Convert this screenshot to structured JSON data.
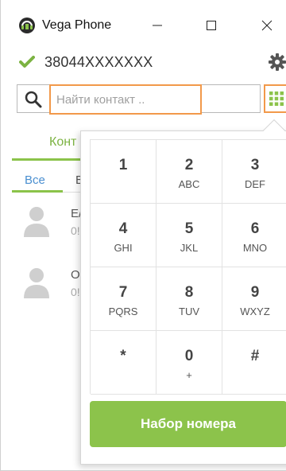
{
  "window": {
    "title": "Vega Phone"
  },
  "status": {
    "phone_number": "38044XXXXXXX",
    "online_color": "#7cb342"
  },
  "search": {
    "placeholder": "Найти контакт ..",
    "value": ""
  },
  "tabs": {
    "contacts_label": "Конт",
    "all_label": "Все",
    "second_label": "В"
  },
  "contacts": [
    {
      "name": "Е/",
      "sub": "0!"
    },
    {
      "name": "О",
      "sub": "0!"
    }
  ],
  "dialpad": {
    "keys": [
      {
        "digit": "1",
        "letters": ""
      },
      {
        "digit": "2",
        "letters": "ABC"
      },
      {
        "digit": "3",
        "letters": "DEF"
      },
      {
        "digit": "4",
        "letters": "GHI"
      },
      {
        "digit": "5",
        "letters": "JKL"
      },
      {
        "digit": "6",
        "letters": "MNO"
      },
      {
        "digit": "7",
        "letters": "PQRS"
      },
      {
        "digit": "8",
        "letters": "TUV"
      },
      {
        "digit": "9",
        "letters": "WXYZ"
      },
      {
        "digit": "*",
        "letters": ""
      },
      {
        "digit": "0",
        "letters": "+"
      },
      {
        "digit": "#",
        "letters": ""
      }
    ],
    "dial_label": "Набор номера",
    "accent_color": "#8cc34b"
  },
  "icons": {
    "logo": "headset-logo-icon",
    "online": "check-icon",
    "settings": "gear-icon",
    "search": "search-icon",
    "dialpad": "dialpad-grid-icon",
    "avatar": "person-icon"
  }
}
